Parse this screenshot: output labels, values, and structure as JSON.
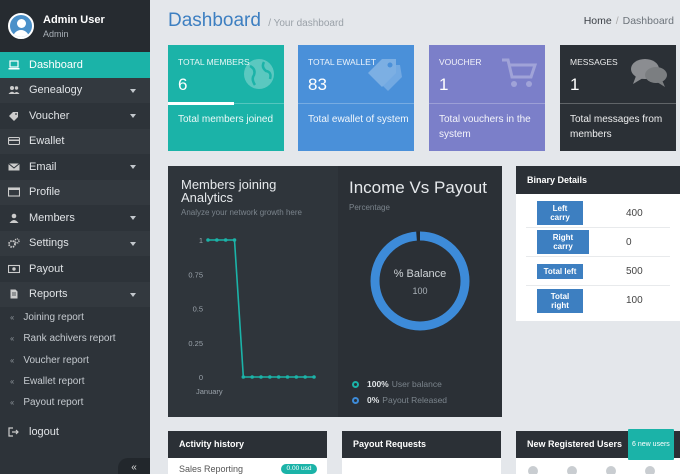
{
  "user": {
    "name": "Admin User",
    "role": "Admin"
  },
  "nav": {
    "items": [
      {
        "label": "Dashboard",
        "icon": "laptop-icon"
      },
      {
        "label": "Genealogy",
        "icon": "users-icon"
      },
      {
        "label": "Voucher",
        "icon": "tag-icon"
      },
      {
        "label": "Ewallet",
        "icon": "card-icon"
      },
      {
        "label": "Email",
        "icon": "envelope-icon"
      },
      {
        "label": "Profile",
        "icon": "id-card-icon"
      },
      {
        "label": "Members",
        "icon": "user-icon"
      },
      {
        "label": "Settings",
        "icon": "gears-icon"
      },
      {
        "label": "Payout",
        "icon": "money-icon"
      },
      {
        "label": "Reports",
        "icon": "file-icon"
      }
    ],
    "reports_sub": [
      "Joining report",
      "Rank achivers report",
      "Voucher report",
      "Ewallet report",
      "Payout report"
    ],
    "logout": "logout",
    "collapse_glyph": "«"
  },
  "header": {
    "title": "Dashboard",
    "subtitle": "/ Your dashboard",
    "crumb_home": "Home",
    "crumb_sep": "/",
    "crumb_current": "Dashboard"
  },
  "stats": [
    {
      "label": "TOTAL MEMBERS",
      "value": "6",
      "desc": "Total members joined",
      "color": "#1bb3a8",
      "icon": "globe-icon",
      "progress": 0.57
    },
    {
      "label": "TOTAL EWALLET",
      "value": "83",
      "desc": "Total ewallet of system",
      "color": "#4a90d9",
      "icon": "tag-icon"
    },
    {
      "label": "VOUCHER",
      "value": "1",
      "desc": "Total vouchers in the system",
      "color": "#7b7fc9",
      "icon": "cart-icon"
    },
    {
      "label": "MESSAGES",
      "value": "1",
      "desc": "Total messages from members",
      "color": "#2b3036",
      "icon": "chat-icon"
    }
  ],
  "members_chart": {
    "title": "Members joining Analytics",
    "subtitle": "Analyze your network growth here"
  },
  "chart_data": {
    "type": "line",
    "x": [
      0,
      1,
      2,
      3,
      4,
      5,
      6,
      7,
      8,
      9,
      10,
      11,
      12
    ],
    "y": [
      1,
      1,
      1,
      1,
      0,
      0,
      0,
      0,
      0,
      0,
      0,
      0,
      0
    ],
    "xlabel": "January",
    "yticks": [
      "1",
      "0.75",
      "0.5",
      "0.25",
      "0"
    ],
    "ylim": [
      0,
      1
    ],
    "color": "#1bb3a8"
  },
  "income": {
    "title": "Income Vs Payout",
    "subtitle": "Percentage",
    "donut_label": "% Balance",
    "donut_value": "100",
    "balance_fraction": 1.0,
    "legend": [
      {
        "value": "100%",
        "label": "User balance"
      },
      {
        "value": "0%",
        "label": "Payout Released"
      }
    ]
  },
  "binary": {
    "title": "Binary Details",
    "rows": [
      {
        "label": "Left carry",
        "value": "400"
      },
      {
        "label": "Right carry",
        "value": "0"
      },
      {
        "label": "Total left",
        "value": "500"
      },
      {
        "label": "Total right",
        "value": "100"
      }
    ]
  },
  "bottom": {
    "activity_title": "Activity history",
    "activity_row": "Sales Reporting",
    "activity_pill": "0.00 usd",
    "payout_title": "Payout Requests",
    "new_users_title": "New Registered Users",
    "new_users_badge": "6 new users"
  }
}
